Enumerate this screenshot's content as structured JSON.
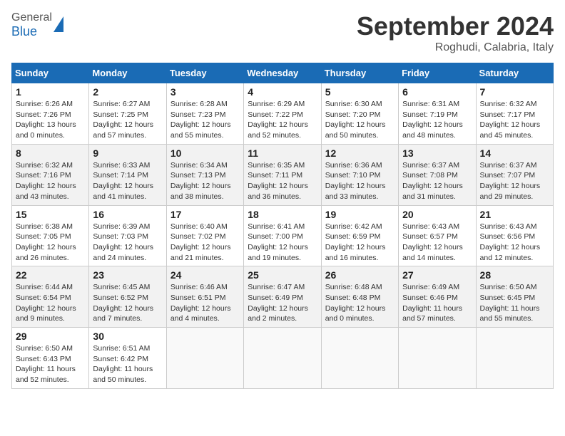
{
  "header": {
    "logo_general": "General",
    "logo_blue": "Blue",
    "month": "September 2024",
    "location": "Roghudi, Calabria, Italy"
  },
  "weekdays": [
    "Sunday",
    "Monday",
    "Tuesday",
    "Wednesday",
    "Thursday",
    "Friday",
    "Saturday"
  ],
  "weeks": [
    [
      {
        "day": "1",
        "info": "Sunrise: 6:26 AM\nSunset: 7:26 PM\nDaylight: 13 hours\nand 0 minutes."
      },
      {
        "day": "2",
        "info": "Sunrise: 6:27 AM\nSunset: 7:25 PM\nDaylight: 12 hours\nand 57 minutes."
      },
      {
        "day": "3",
        "info": "Sunrise: 6:28 AM\nSunset: 7:23 PM\nDaylight: 12 hours\nand 55 minutes."
      },
      {
        "day": "4",
        "info": "Sunrise: 6:29 AM\nSunset: 7:22 PM\nDaylight: 12 hours\nand 52 minutes."
      },
      {
        "day": "5",
        "info": "Sunrise: 6:30 AM\nSunset: 7:20 PM\nDaylight: 12 hours\nand 50 minutes."
      },
      {
        "day": "6",
        "info": "Sunrise: 6:31 AM\nSunset: 7:19 PM\nDaylight: 12 hours\nand 48 minutes."
      },
      {
        "day": "7",
        "info": "Sunrise: 6:32 AM\nSunset: 7:17 PM\nDaylight: 12 hours\nand 45 minutes."
      }
    ],
    [
      {
        "day": "8",
        "info": "Sunrise: 6:32 AM\nSunset: 7:16 PM\nDaylight: 12 hours\nand 43 minutes."
      },
      {
        "day": "9",
        "info": "Sunrise: 6:33 AM\nSunset: 7:14 PM\nDaylight: 12 hours\nand 41 minutes."
      },
      {
        "day": "10",
        "info": "Sunrise: 6:34 AM\nSunset: 7:13 PM\nDaylight: 12 hours\nand 38 minutes."
      },
      {
        "day": "11",
        "info": "Sunrise: 6:35 AM\nSunset: 7:11 PM\nDaylight: 12 hours\nand 36 minutes."
      },
      {
        "day": "12",
        "info": "Sunrise: 6:36 AM\nSunset: 7:10 PM\nDaylight: 12 hours\nand 33 minutes."
      },
      {
        "day": "13",
        "info": "Sunrise: 6:37 AM\nSunset: 7:08 PM\nDaylight: 12 hours\nand 31 minutes."
      },
      {
        "day": "14",
        "info": "Sunrise: 6:37 AM\nSunset: 7:07 PM\nDaylight: 12 hours\nand 29 minutes."
      }
    ],
    [
      {
        "day": "15",
        "info": "Sunrise: 6:38 AM\nSunset: 7:05 PM\nDaylight: 12 hours\nand 26 minutes."
      },
      {
        "day": "16",
        "info": "Sunrise: 6:39 AM\nSunset: 7:03 PM\nDaylight: 12 hours\nand 24 minutes."
      },
      {
        "day": "17",
        "info": "Sunrise: 6:40 AM\nSunset: 7:02 PM\nDaylight: 12 hours\nand 21 minutes."
      },
      {
        "day": "18",
        "info": "Sunrise: 6:41 AM\nSunset: 7:00 PM\nDaylight: 12 hours\nand 19 minutes."
      },
      {
        "day": "19",
        "info": "Sunrise: 6:42 AM\nSunset: 6:59 PM\nDaylight: 12 hours\nand 16 minutes."
      },
      {
        "day": "20",
        "info": "Sunrise: 6:43 AM\nSunset: 6:57 PM\nDaylight: 12 hours\nand 14 minutes."
      },
      {
        "day": "21",
        "info": "Sunrise: 6:43 AM\nSunset: 6:56 PM\nDaylight: 12 hours\nand 12 minutes."
      }
    ],
    [
      {
        "day": "22",
        "info": "Sunrise: 6:44 AM\nSunset: 6:54 PM\nDaylight: 12 hours\nand 9 minutes."
      },
      {
        "day": "23",
        "info": "Sunrise: 6:45 AM\nSunset: 6:52 PM\nDaylight: 12 hours\nand 7 minutes."
      },
      {
        "day": "24",
        "info": "Sunrise: 6:46 AM\nSunset: 6:51 PM\nDaylight: 12 hours\nand 4 minutes."
      },
      {
        "day": "25",
        "info": "Sunrise: 6:47 AM\nSunset: 6:49 PM\nDaylight: 12 hours\nand 2 minutes."
      },
      {
        "day": "26",
        "info": "Sunrise: 6:48 AM\nSunset: 6:48 PM\nDaylight: 12 hours\nand 0 minutes."
      },
      {
        "day": "27",
        "info": "Sunrise: 6:49 AM\nSunset: 6:46 PM\nDaylight: 11 hours\nand 57 minutes."
      },
      {
        "day": "28",
        "info": "Sunrise: 6:50 AM\nSunset: 6:45 PM\nDaylight: 11 hours\nand 55 minutes."
      }
    ],
    [
      {
        "day": "29",
        "info": "Sunrise: 6:50 AM\nSunset: 6:43 PM\nDaylight: 11 hours\nand 52 minutes."
      },
      {
        "day": "30",
        "info": "Sunrise: 6:51 AM\nSunset: 6:42 PM\nDaylight: 11 hours\nand 50 minutes."
      },
      {
        "day": "",
        "info": ""
      },
      {
        "day": "",
        "info": ""
      },
      {
        "day": "",
        "info": ""
      },
      {
        "day": "",
        "info": ""
      },
      {
        "day": "",
        "info": ""
      }
    ]
  ]
}
